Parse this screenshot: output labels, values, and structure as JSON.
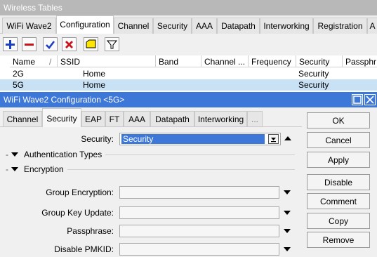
{
  "back_window": {
    "title": "Wireless Tables",
    "tabs": [
      "WiFi Wave2",
      "Configuration",
      "Channel",
      "Security",
      "AAA",
      "Datapath",
      "Interworking",
      "Registration",
      "A"
    ],
    "active_tab": "Configuration",
    "toolbar": [
      "add-icon",
      "remove-icon",
      "enable-check-icon",
      "disable-x-icon",
      "comment-note-icon",
      "filter-icon"
    ],
    "table": {
      "columns": [
        "Name",
        "SSID",
        "Band",
        "Channel ...",
        "Frequency",
        "Security",
        "Passphr"
      ],
      "sort_indicator": "/",
      "rows": [
        {
          "name": "2G",
          "ssid": "Home",
          "band": "",
          "channel": "",
          "frequency": "",
          "security": "Security",
          "passphrase": ""
        },
        {
          "name": "5G",
          "ssid": "Home",
          "band": "",
          "channel": "",
          "frequency": "",
          "security": "Security",
          "passphrase": ""
        }
      ],
      "selected_row": 1,
      "selected_color": "#c8e1f5"
    }
  },
  "dialog": {
    "title": "WiFi Wave2 Configuration <5G>",
    "title_bar_color": "#3d78d8",
    "tabs": [
      "Channel",
      "Security",
      "EAP",
      "FT",
      "AAA",
      "Datapath",
      "Interworking",
      "..."
    ],
    "active_tab": "Security",
    "security": {
      "label": "Security:",
      "value": "Security",
      "highlight_color": "#3d78d8"
    },
    "sections": [
      "Authentication Types",
      "Encryption"
    ],
    "fields": [
      {
        "label": "Group Encryption:",
        "value": ""
      },
      {
        "label": "Group Key Update:",
        "value": ""
      },
      {
        "label": "Passphrase:",
        "value": ""
      },
      {
        "label": "Disable PMKID:",
        "value": ""
      }
    ],
    "buttons": [
      "OK",
      "Cancel",
      "Apply",
      "Disable",
      "Comment",
      "Copy",
      "Remove"
    ]
  }
}
